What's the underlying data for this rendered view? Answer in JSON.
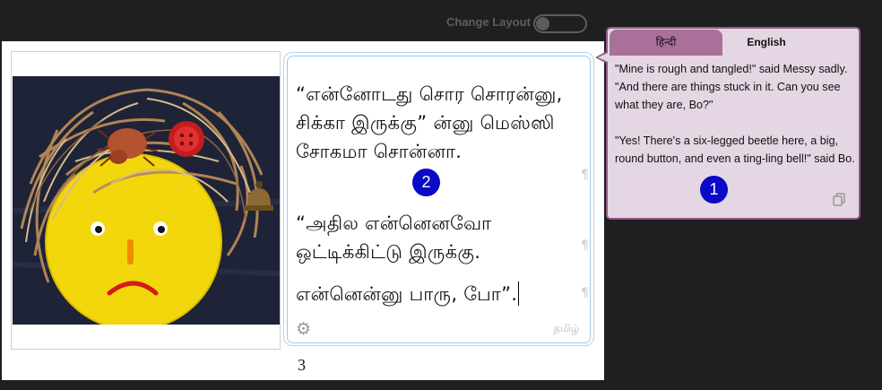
{
  "toolbar": {
    "change_layout_label": "Change Layout",
    "layout_toggle_on": false
  },
  "page": {
    "number": "3",
    "picture_alt": "Messy face collage with straw hair, a beetle, a red button and a bell"
  },
  "tamil_text": {
    "paragraph_1": "“என்னோடது சொர சொரன்னு, சிக்கா இருக்கு” ன்னு மெஸ்ஸி சோகமா சொன்னா.",
    "paragraph_2": "“அதில என்னெனவோ ஒட்டிக்கிட்டு இருக்கு.",
    "paragraph_3": "என்னென்னு பாரு, போ”.",
    "pilcrow": "¶",
    "language_label": "தமிழ்"
  },
  "badges": {
    "one": "1",
    "two": "2"
  },
  "translation_bubble": {
    "tabs": [
      {
        "label": "हिन्दी",
        "active": false
      },
      {
        "label": "English",
        "active": true
      }
    ],
    "paragraphs": [
      "\"Mine is rough and tangled!\" said Messy sadly. \"And there are things stuck in it. Can you see what they are, Bo?\"",
      "\"Yes! There's a six-legged beetle here, a big, round button, and even a ting-ling bell!\" said Bo."
    ]
  },
  "icons": {
    "settings": "gear-icon",
    "copy": "copy-icon"
  },
  "colors": {
    "app_background": "#1f1f1f",
    "bubble_background": "#e4d6e3",
    "bubble_border": "#8f5a86",
    "hindi_tab": "#a9709a",
    "badge": "#0a0ac8",
    "text_box_border": "#9ccbf0"
  }
}
